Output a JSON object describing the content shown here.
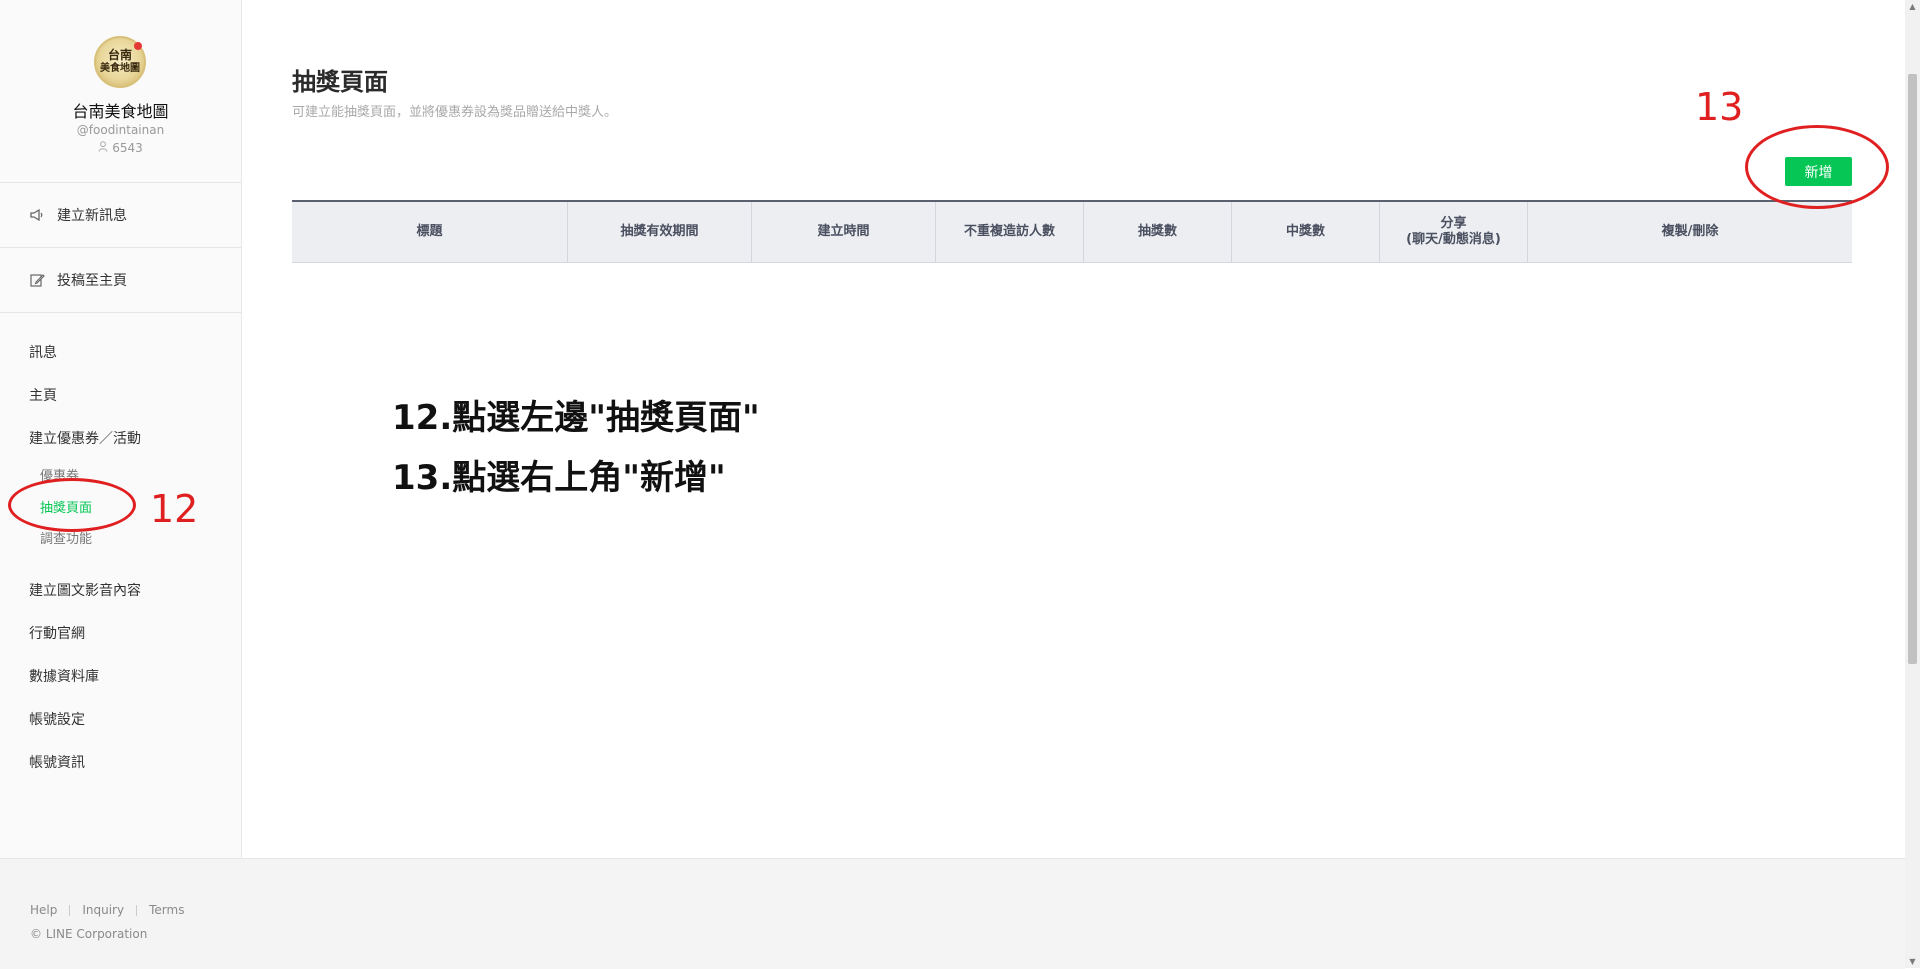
{
  "account": {
    "logo_line1": "台南",
    "logo_line2": "美食地圖",
    "name": "台南美食地圖",
    "id": "@foodintainan",
    "followers": "6543"
  },
  "sidebar": {
    "actions": [
      {
        "label": "建立新訊息",
        "icon": "megaphone-icon"
      },
      {
        "label": "投稿至主頁",
        "icon": "edit-icon"
      }
    ],
    "nav": {
      "messages": "訊息",
      "home": "主頁",
      "coupons_events": "建立優惠券／活動",
      "sub_coupon": "優惠券",
      "sub_lottery": "抽獎頁面",
      "sub_survey": "調查功能",
      "media": "建立圖文影音內容",
      "mobile_site": "行動官網",
      "database": "數據資料庫",
      "account_settings": "帳號設定",
      "account_info": "帳號資訊"
    }
  },
  "main": {
    "title": "抽獎頁面",
    "description": "可建立能抽獎頁面，並將優惠券設為獎品贈送給中獎人。",
    "add_button": "新增",
    "table_headers": [
      "標題",
      "抽獎有效期間",
      "建立時間",
      "不重複造訪人數",
      "抽獎數",
      "中獎數",
      "分享\n(聊天/動態消息)",
      "複製/刪除"
    ]
  },
  "annotations": {
    "num_12": "12",
    "num_13": "13",
    "line1": "12.點選左邊\"抽獎頁面\"",
    "line2": "13.點選右上角\"新增\"",
    "color": "#e02020"
  },
  "footer": {
    "links": [
      "Help",
      "Inquiry",
      "Terms"
    ],
    "copyright": "© LINE Corporation"
  },
  "colors": {
    "accent": "#06c755",
    "header_bg": "#eceef2"
  }
}
